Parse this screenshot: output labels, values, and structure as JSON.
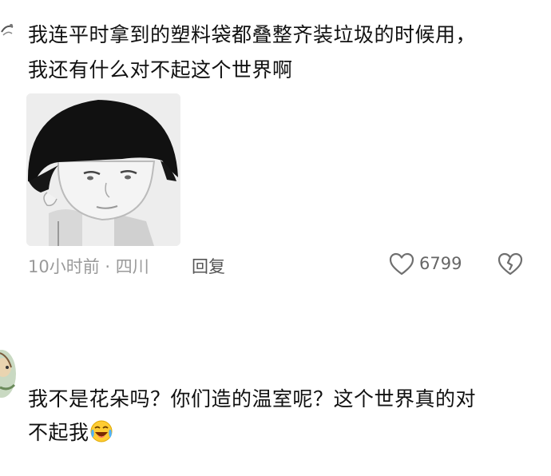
{
  "comment1": {
    "text_line1": "我连平时拿到的塑料袋都叠整齐装垃圾的时候用，",
    "text_line2": "我还有什么对不起这个世界啊",
    "sticker_icon": "bowl-cut-cartoon-face-sticker",
    "time_location": "10小时前 · 四川",
    "reply_label": "回复",
    "like_icon": "heart-outline-icon",
    "like_count": "6799",
    "dislike_icon": "broken-heart-icon"
  },
  "comment2": {
    "text_line1": "我不是花朵吗？你们造的温室呢？这个世界真的对",
    "text_line2": "不起我",
    "emoji": "laughing-crying-emoji"
  },
  "colors": {
    "text": "#111111",
    "meta": "#9a9a9a",
    "reply": "#555555",
    "icon": "#777777"
  }
}
